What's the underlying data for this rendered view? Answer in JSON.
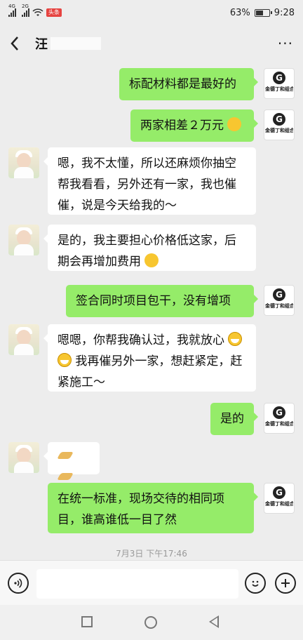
{
  "status_bar": {
    "network_left": "4G",
    "network_right": "2G",
    "badge": "头条",
    "battery_percent": "63%",
    "battery_level": 0.63,
    "time": "9:28"
  },
  "chat_header": {
    "title": "汪",
    "back_icon": "chevron-left-icon",
    "more_icon": "more-dots-icon",
    "more_label": "···"
  },
  "company_avatar": {
    "logo_letter": "G",
    "logo_text": "金德丁和组合"
  },
  "messages": [
    {
      "side": "out",
      "text": "标配材料都是最好的"
    },
    {
      "side": "out",
      "text": "两家相差２万元",
      "emoji": "thinking-face"
    },
    {
      "side": "in",
      "text": "嗯，我不太懂，所以还麻烦你抽空帮我看看，另外还有一家，我也催催，说是今天给我的～"
    },
    {
      "side": "in",
      "text": "是的，我主要担心价格低这家，后期会再增加费用",
      "emoji": "thinking-face"
    },
    {
      "side": "out",
      "text": "签合同时项目包干，没有增项"
    },
    {
      "side": "in",
      "text_before": "嗯嗯，你帮我确认过，我就放心",
      "text_after": "我再催另外一家，想赶紧定，赶紧施工～",
      "emoji": "grinning-face"
    },
    {
      "side": "out",
      "text": "是的"
    },
    {
      "side": "in",
      "emoji": "folded-hands"
    },
    {
      "side": "out",
      "text": "在统一标准，现场交待的相同项目，谁高谁低一目了然"
    }
  ],
  "timestamp": "7月3日 下午17:46",
  "input_bar": {
    "voice_icon": "voice-icon",
    "emoji_icon": "emoji-icon",
    "plus_icon": "plus-icon",
    "input_value": ""
  },
  "nav_bar": {
    "recents_icon": "square-icon",
    "home_icon": "circle-icon",
    "back_icon": "triangle-back-icon"
  }
}
